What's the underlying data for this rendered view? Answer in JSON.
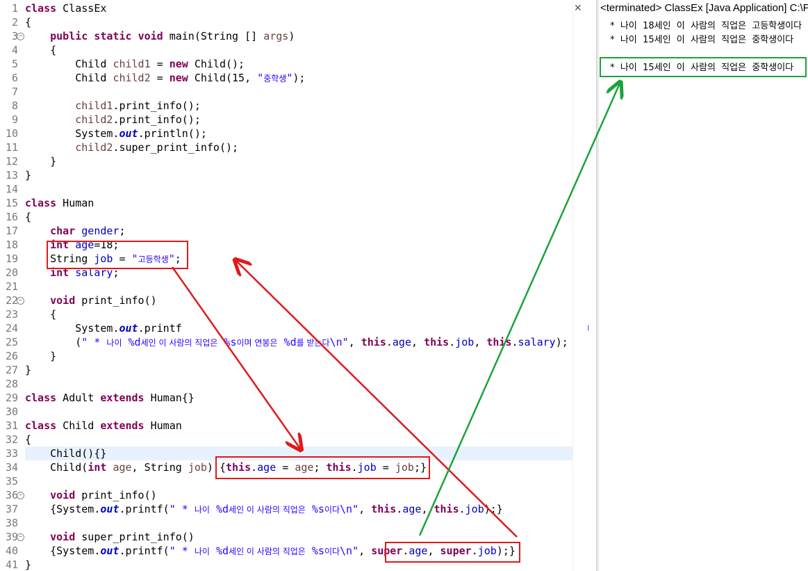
{
  "editor": {
    "lines": [
      {
        "n": "1",
        "html": "<span class='kw'>class</span> ClassEx"
      },
      {
        "n": "2",
        "html": "{"
      },
      {
        "n": "3",
        "html": "    <span class='kw'>public</span> <span class='kw'>static</span> <span class='kw'>void</span> main(String [] <span style='color:#6a3e3e'>args</span>)"
      },
      {
        "n": "4",
        "html": "    {"
      },
      {
        "n": "5",
        "html": "        Child <span style='color:#6a3e3e'>child1</span> = <span class='kw'>new</span> Child();"
      },
      {
        "n": "6",
        "html": "        Child <span style='color:#6a3e3e'>child2</span> = <span class='kw'>new</span> Child(15, <span class='st'>\"<span class='ko'>중학생</span>\"</span>);"
      },
      {
        "n": "7",
        "html": ""
      },
      {
        "n": "8",
        "html": "        <span style='color:#6a3e3e'>child1</span>.print_info();"
      },
      {
        "n": "9",
        "html": "        <span style='color:#6a3e3e'>child2</span>.print_info();"
      },
      {
        "n": "10",
        "html": "        System.<span class='sti'>out</span>.println();"
      },
      {
        "n": "11",
        "html": "        <span style='color:#6a3e3e'>child2</span>.super_print_info();"
      },
      {
        "n": "12",
        "html": "    }"
      },
      {
        "n": "13",
        "html": "}"
      },
      {
        "n": "14",
        "html": ""
      },
      {
        "n": "15",
        "html": "<span class='kw'>class</span> Human"
      },
      {
        "n": "16",
        "html": "{"
      },
      {
        "n": "17",
        "html": "    <span class='kw'>char</span> <span class='fd'>gender</span>;"
      },
      {
        "n": "18",
        "html": "    <span class='kw'>int</span> <span class='fd'>age</span>=18;"
      },
      {
        "n": "19",
        "html": "    String <span class='fd'>job</span> = <span class='st'>\"<span class='ko'>고등학생</span>\"</span>;"
      },
      {
        "n": "20",
        "html": "    <span class='kw'>int</span> <span class='fd'>salary</span>;"
      },
      {
        "n": "21",
        "html": ""
      },
      {
        "n": "22",
        "html": "    <span class='kw'>void</span> print_info()"
      },
      {
        "n": "23",
        "html": "    {"
      },
      {
        "n": "24",
        "html": "        System.<span class='sti'>out</span>.printf"
      },
      {
        "n": "25",
        "html": "        (<span class='st'>\" * <span class='ko'>나이</span> %d<span class='ko'>세인 이 사람의 직업은</span> %s<span class='ko'>이며 연봉은</span> %d<span class='ko'>를 받는다</span>\\n\"</span>, <span class='kw'>this</span>.<span class='fd'>age</span>, <span class='kw'>this</span>.<span class='fd'>job</span>, <span class='kw'>this</span>.<span class='fd'>salary</span>);"
      },
      {
        "n": "26",
        "html": "    }"
      },
      {
        "n": "27",
        "html": "}"
      },
      {
        "n": "28",
        "html": ""
      },
      {
        "n": "29",
        "html": "<span class='kw'>class</span> Adult <span class='kw'>extends</span> Human{}"
      },
      {
        "n": "30",
        "html": ""
      },
      {
        "n": "31",
        "html": "<span class='kw'>class</span> Child <span class='kw'>extends</span> Human"
      },
      {
        "n": "32",
        "html": "{"
      },
      {
        "n": "33",
        "html": "    Child(){}"
      },
      {
        "n": "34",
        "html": "    Child(<span class='kw'>int</span> <span style='color:#6a3e3e'>age</span>, String <span style='color:#6a3e3e'>job</span>) {<span class='kw'>this</span>.<span class='fd'>age</span> = <span style='color:#6a3e3e'>age</span>; <span class='kw'>this</span>.<span class='fd'>job</span> = <span style='color:#6a3e3e'>job</span>;}"
      },
      {
        "n": "35",
        "html": ""
      },
      {
        "n": "36",
        "html": "    <span class='kw'>void</span> print_info()"
      },
      {
        "n": "37",
        "html": "    {System.<span class='sti'>out</span>.printf(<span class='st'>\" * <span class='ko'>나이</span> %d<span class='ko'>세인 이 사람의 직업은</span> %s<span class='ko'>이다</span>\\n\"</span>, <span class='kw'>this</span>.<span class='fd'>age</span>, <span class='kw'>this</span>.<span class='fd'>job</span>);}"
      },
      {
        "n": "38",
        "html": ""
      },
      {
        "n": "39",
        "html": "    <span class='kw'>void</span> super_print_info()"
      },
      {
        "n": "40",
        "html": "    {System.<span class='sti'>out</span>.printf(<span class='st'>\" * <span class='ko'>나이</span> %d<span class='ko'>세인 이 사람의 직업은</span> %s<span class='ko'>이다</span>\\n\"</span>, <span class='kw'>super</span>.<span class='fd'>age</span>, <span class='kw'>super</span>.<span class='fd'>job</span>);}"
      },
      {
        "n": "41",
        "html": "}"
      }
    ],
    "fold_markers": [
      "3",
      "22",
      "36",
      "39"
    ],
    "current_line": "33",
    "close_glyph": "✕"
  },
  "console": {
    "header": "<terminated> ClassEx [Java Application] C:\\Program Files\\Java",
    "output": [
      " *  나이  18세인  이  사람의  직업은  고등학생이다",
      " *  나이  15세인  이  사람의  직업은  중학생이다",
      "",
      " *  나이  15세인  이  사람의  직업은  중학생이다"
    ]
  },
  "annotations": {
    "red_color": "#e0191b",
    "green_color": "#1aa33a"
  }
}
